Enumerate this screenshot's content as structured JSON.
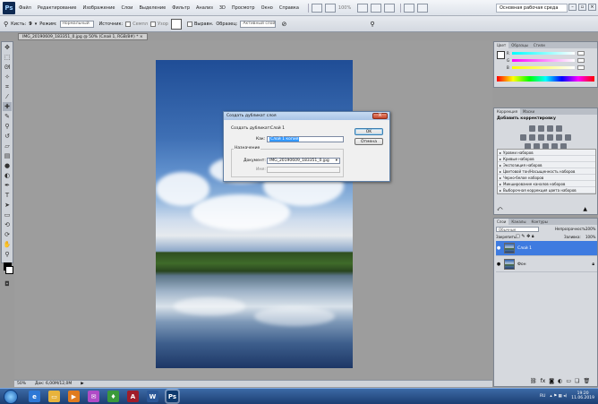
{
  "app": {
    "logo_text": "Ps"
  },
  "menu": {
    "items": [
      "Файл",
      "Редактирование",
      "Изображение",
      "Слои",
      "Выделение",
      "Фильтр",
      "Анализ",
      "3D",
      "Просмотр",
      "Окно",
      "Справка"
    ],
    "zoom": "100%",
    "workspace": "Основная рабочая среда"
  },
  "options_bar": {
    "brush_label": "Кисть:",
    "brush_size": "9",
    "mode_label": "Режим:",
    "mode_value": "Нормальный",
    "opacity_label": "Источник:",
    "source1": "Семпл",
    "source2": "Узор",
    "aligned_label": "Выравн.",
    "sample_label": "Образец:",
    "sample_value": "Активный слой"
  },
  "document_tab": {
    "title": "IMG_20190609_183351_0.jpg @ 50% (Слой 1, RGB/8#) * ×"
  },
  "dialog": {
    "title": "Создать дубликат слоя",
    "close": "X",
    "duplicate_label": "Создать дубликат:",
    "duplicate_value": "Слой 1",
    "as_label": "Как:",
    "as_value": "Слой 1 копия",
    "ok": "OK",
    "cancel": "Отмена",
    "group_label": "Назначение",
    "document_label": "Документ:",
    "document_value": "IMG_20190609_183351_0.jpg",
    "name_label": "Имя:"
  },
  "color_panel": {
    "tabs": [
      "Цвет",
      "Образцы",
      "Стили"
    ],
    "sliders": [
      "R",
      "G",
      "B"
    ],
    "values": [
      "255",
      "255",
      "255"
    ]
  },
  "adjustments_panel": {
    "tabs": [
      "Коррекция",
      "Маски"
    ],
    "title": "Добавить корректировку",
    "presets": [
      "Уровни наборов",
      "Кривые наборов",
      "Экспозиция наборов",
      "Цветовой тон/Насыщенность наборов",
      "Черно-белое наборов",
      "Микширование каналов наборов",
      "Выборочная коррекция цвета наборов"
    ]
  },
  "layers_panel": {
    "tabs": [
      "Слои",
      "Каналы",
      "Контуры"
    ],
    "blend_mode": "Обычные",
    "opacity_label": "Непрозрачность:",
    "opacity_value": "100%",
    "lock_label": "Закрепить:",
    "fill_label": "Заливка:",
    "fill_value": "100%",
    "layers": [
      {
        "name": "Слой 1",
        "active": true
      },
      {
        "name": "Фон",
        "active": false
      }
    ]
  },
  "status_bar": {
    "zoom": "50%",
    "doc_info": "Док: 6,00M/12,0M"
  },
  "taskbar": {
    "language": "RU",
    "time": "19:20",
    "date": "11.06.2019",
    "apps": [
      {
        "icon": "explorer-icon",
        "color": "#2e78d6",
        "glyph": "e"
      },
      {
        "icon": "folder-icon",
        "color": "#e8b33c",
        "glyph": "▭"
      },
      {
        "icon": "media-icon",
        "color": "#e07b1e",
        "glyph": "▶"
      },
      {
        "icon": "mail-icon",
        "color": "#b04bc7",
        "glyph": "✉"
      },
      {
        "icon": "green-app-icon",
        "color": "#3a9a3a",
        "glyph": "♦"
      },
      {
        "icon": "access-icon",
        "color": "#a01d2a",
        "glyph": "A"
      },
      {
        "icon": "word-icon",
        "color": "#2b5797",
        "glyph": "W"
      },
      {
        "icon": "photoshop-icon",
        "color": "#0d3a6e",
        "glyph": "Ps"
      }
    ]
  }
}
